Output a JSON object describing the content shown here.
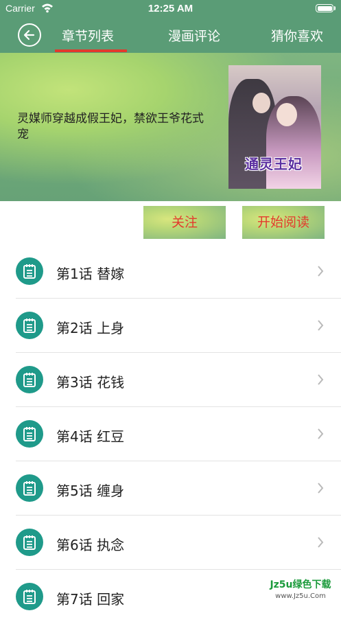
{
  "status_bar": {
    "carrier": "Carrier",
    "time": "12:25 AM"
  },
  "nav": {
    "tabs": [
      {
        "label": "章节列表"
      },
      {
        "label": "漫画评论"
      },
      {
        "label": "猜你喜欢"
      }
    ],
    "active_color": "#e23a2d",
    "bar_color": "#5a9c76"
  },
  "comic": {
    "description": "灵媒师穿越成假王妃，禁欲王爷花式宠",
    "cover_title": "通灵王妃"
  },
  "actions": {
    "follow_label": "关注",
    "read_label": "开始阅读"
  },
  "chapters": [
    {
      "label": "第1话 替嫁"
    },
    {
      "label": "第2话 上身"
    },
    {
      "label": "第3话 花钱"
    },
    {
      "label": "第4话 红豆"
    },
    {
      "label": "第5话 缠身"
    },
    {
      "label": "第6话 执念"
    },
    {
      "label": "第7话 回家"
    }
  ],
  "watermark": {
    "line1": "Jz5u绿色下载",
    "line2": "www.Jz5u.Com"
  }
}
